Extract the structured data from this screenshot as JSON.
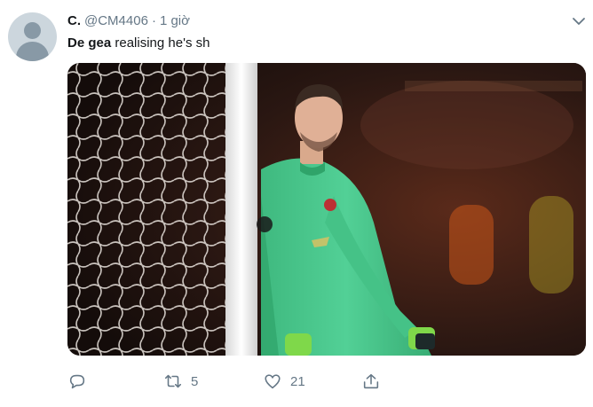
{
  "tweet": {
    "author_name": "C.",
    "handle": "@CM4406",
    "separator": "·",
    "time": "1 giờ",
    "text_bold": "De gea",
    "text_rest": " realising he's sh",
    "media_alt_icon": "photo",
    "actions": {
      "reply_icon": "reply-icon",
      "retweet_icon": "retweet-icon",
      "retweet_count": "5",
      "like_icon": "heart-icon",
      "like_count": "21",
      "share_icon": "share-icon"
    }
  },
  "colors": {
    "text": "#14171a",
    "secondary": "#657786",
    "kit_green": "#49c98d"
  }
}
